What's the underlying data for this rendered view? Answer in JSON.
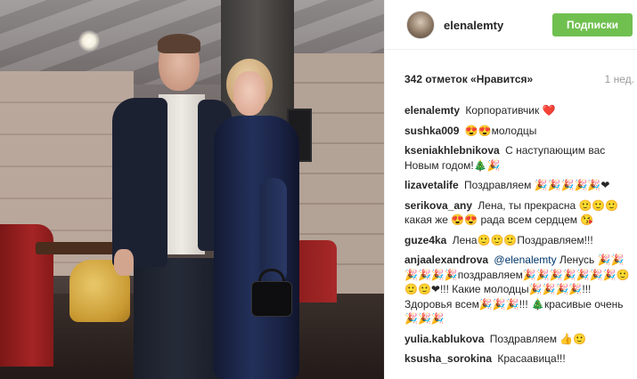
{
  "post": {
    "username": "elenalemty",
    "follow_label": "Подписки",
    "likes": "342 отметок «Нравится»",
    "time": "1 нед."
  },
  "comments": [
    {
      "author": "elenalemty",
      "text": "Корпоративчик ❤️"
    },
    {
      "author": "sushka009",
      "text": "😍😍молодцы"
    },
    {
      "author": "kseniakhlebnikova",
      "text": "С наступающим вас Новым годом!🎄🎉"
    },
    {
      "author": "lizavetalife",
      "text": "Поздравляем 🎉🎉🎉🎉🎉❤"
    },
    {
      "author": "serikova_any",
      "text": "Лена, ты прекрасна 🙂🙂🙂 какая же 😍😍 рада всем сердцем 😘"
    },
    {
      "author": "guze4ka",
      "text": "Лена🙂🙂🙂Поздравляем!!!"
    },
    {
      "author": "anjaalexandrova",
      "mention": "@elenalemty",
      "text": "Ленусь 🎉🎉🎉🎉🎉🎉поздравляем🎉🎉🎉🎉🎉🎉🎉🙂🙂🙂❤!!! Какие молодцы🎉🎉🎉🎉!!! Здоровья всем🎉🎉🎉!!! 🎄красивые очень🎉🎉🎉"
    },
    {
      "author": "yulia.kablukova",
      "text": "Поздравляем 👍🙂"
    },
    {
      "author": "ksusha_sorokina",
      "text": "Красаавица!!!"
    }
  ]
}
